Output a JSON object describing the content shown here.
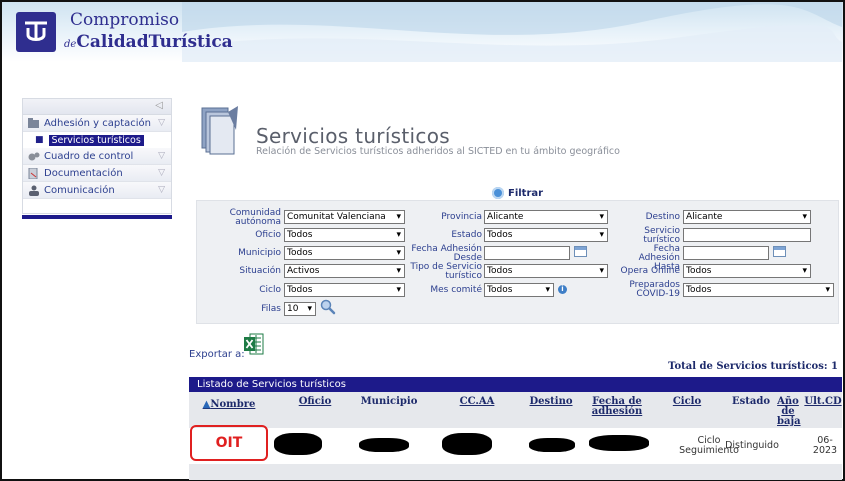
{
  "brand": {
    "line1": "Compromiso",
    "line2_prefix": "de",
    "line2_main": "CalidadTurística"
  },
  "sidebar": {
    "items": [
      {
        "label": "Adhesión y captación",
        "icon": "folder-icon"
      },
      {
        "label": "Servicios turísticos",
        "icon": "bullet"
      },
      {
        "label": "Cuadro de control",
        "icon": "gear-icon"
      },
      {
        "label": "Documentación",
        "icon": "document-icon"
      },
      {
        "label": "Comunicación",
        "icon": "person-icon"
      }
    ]
  },
  "page": {
    "title": "Servicios turísticos",
    "subtitle": "Relación de Servicios turísticos adheridos al SICTED en tu ámbito geográfico"
  },
  "filter": {
    "toggle_label": "Filtrar",
    "comunidad_label": "Comunidad autónoma",
    "comunidad_value": "Comunitat Valenciana",
    "oficio_label": "Oficio",
    "oficio_value": "Todos",
    "municipio_label": "Municipio",
    "municipio_value": "Todos",
    "situacion_label": "Situación",
    "situacion_value": "Activos",
    "ciclo_label": "Ciclo",
    "ciclo_value": "Todos",
    "filas_label": "Filas",
    "filas_value": "10",
    "provincia_label": "Provincia",
    "provincia_value": "Alicante",
    "estado_label": "Estado",
    "estado_value": "Todos",
    "fecha_desde_label": "Fecha Adhesión Desde",
    "fecha_desde_value": "",
    "tipo_servicio_label": "Tipo de Servicio turístico",
    "tipo_servicio_value": "Todos",
    "mes_comite_label": "Mes comité",
    "mes_comite_value": "Todos",
    "destino_label": "Destino",
    "destino_value": "Alicante",
    "servicio_turistico_label": "Servicio turístico",
    "servicio_turistico_value": "",
    "fecha_hasta_label": "Fecha Adhesión Hasta",
    "fecha_hasta_value": "",
    "opera_online_label": "Opera Online",
    "opera_online_value": "Todos",
    "covid_label": "Preparados COVID-19",
    "covid_value": "Todos"
  },
  "export": {
    "label": "Exportar a:",
    "total_label": "Total de Servicios turísticos: 1"
  },
  "table": {
    "title": "Listado de Servicios turísticos",
    "columns": [
      "Nombre",
      "Oficio",
      "Municipio",
      "CC.AA",
      "Destino",
      "Fecha de adhesión",
      "Ciclo",
      "Estado",
      "Año de baja",
      "Ult.CD"
    ],
    "rows": [
      {
        "nombre": "OIT",
        "oficio": "",
        "municipio": "",
        "ccaa": "",
        "destino": "",
        "fecha": "",
        "ciclo": "Ciclo Seguimiento",
        "estado": "Distinguido",
        "anio_baja": "",
        "ult_cd": "06-2023"
      }
    ]
  },
  "colors": {
    "brand_navy": "#1d1a8a",
    "highlight_red": "#e02020",
    "panel_bg": "#eef0f3"
  }
}
